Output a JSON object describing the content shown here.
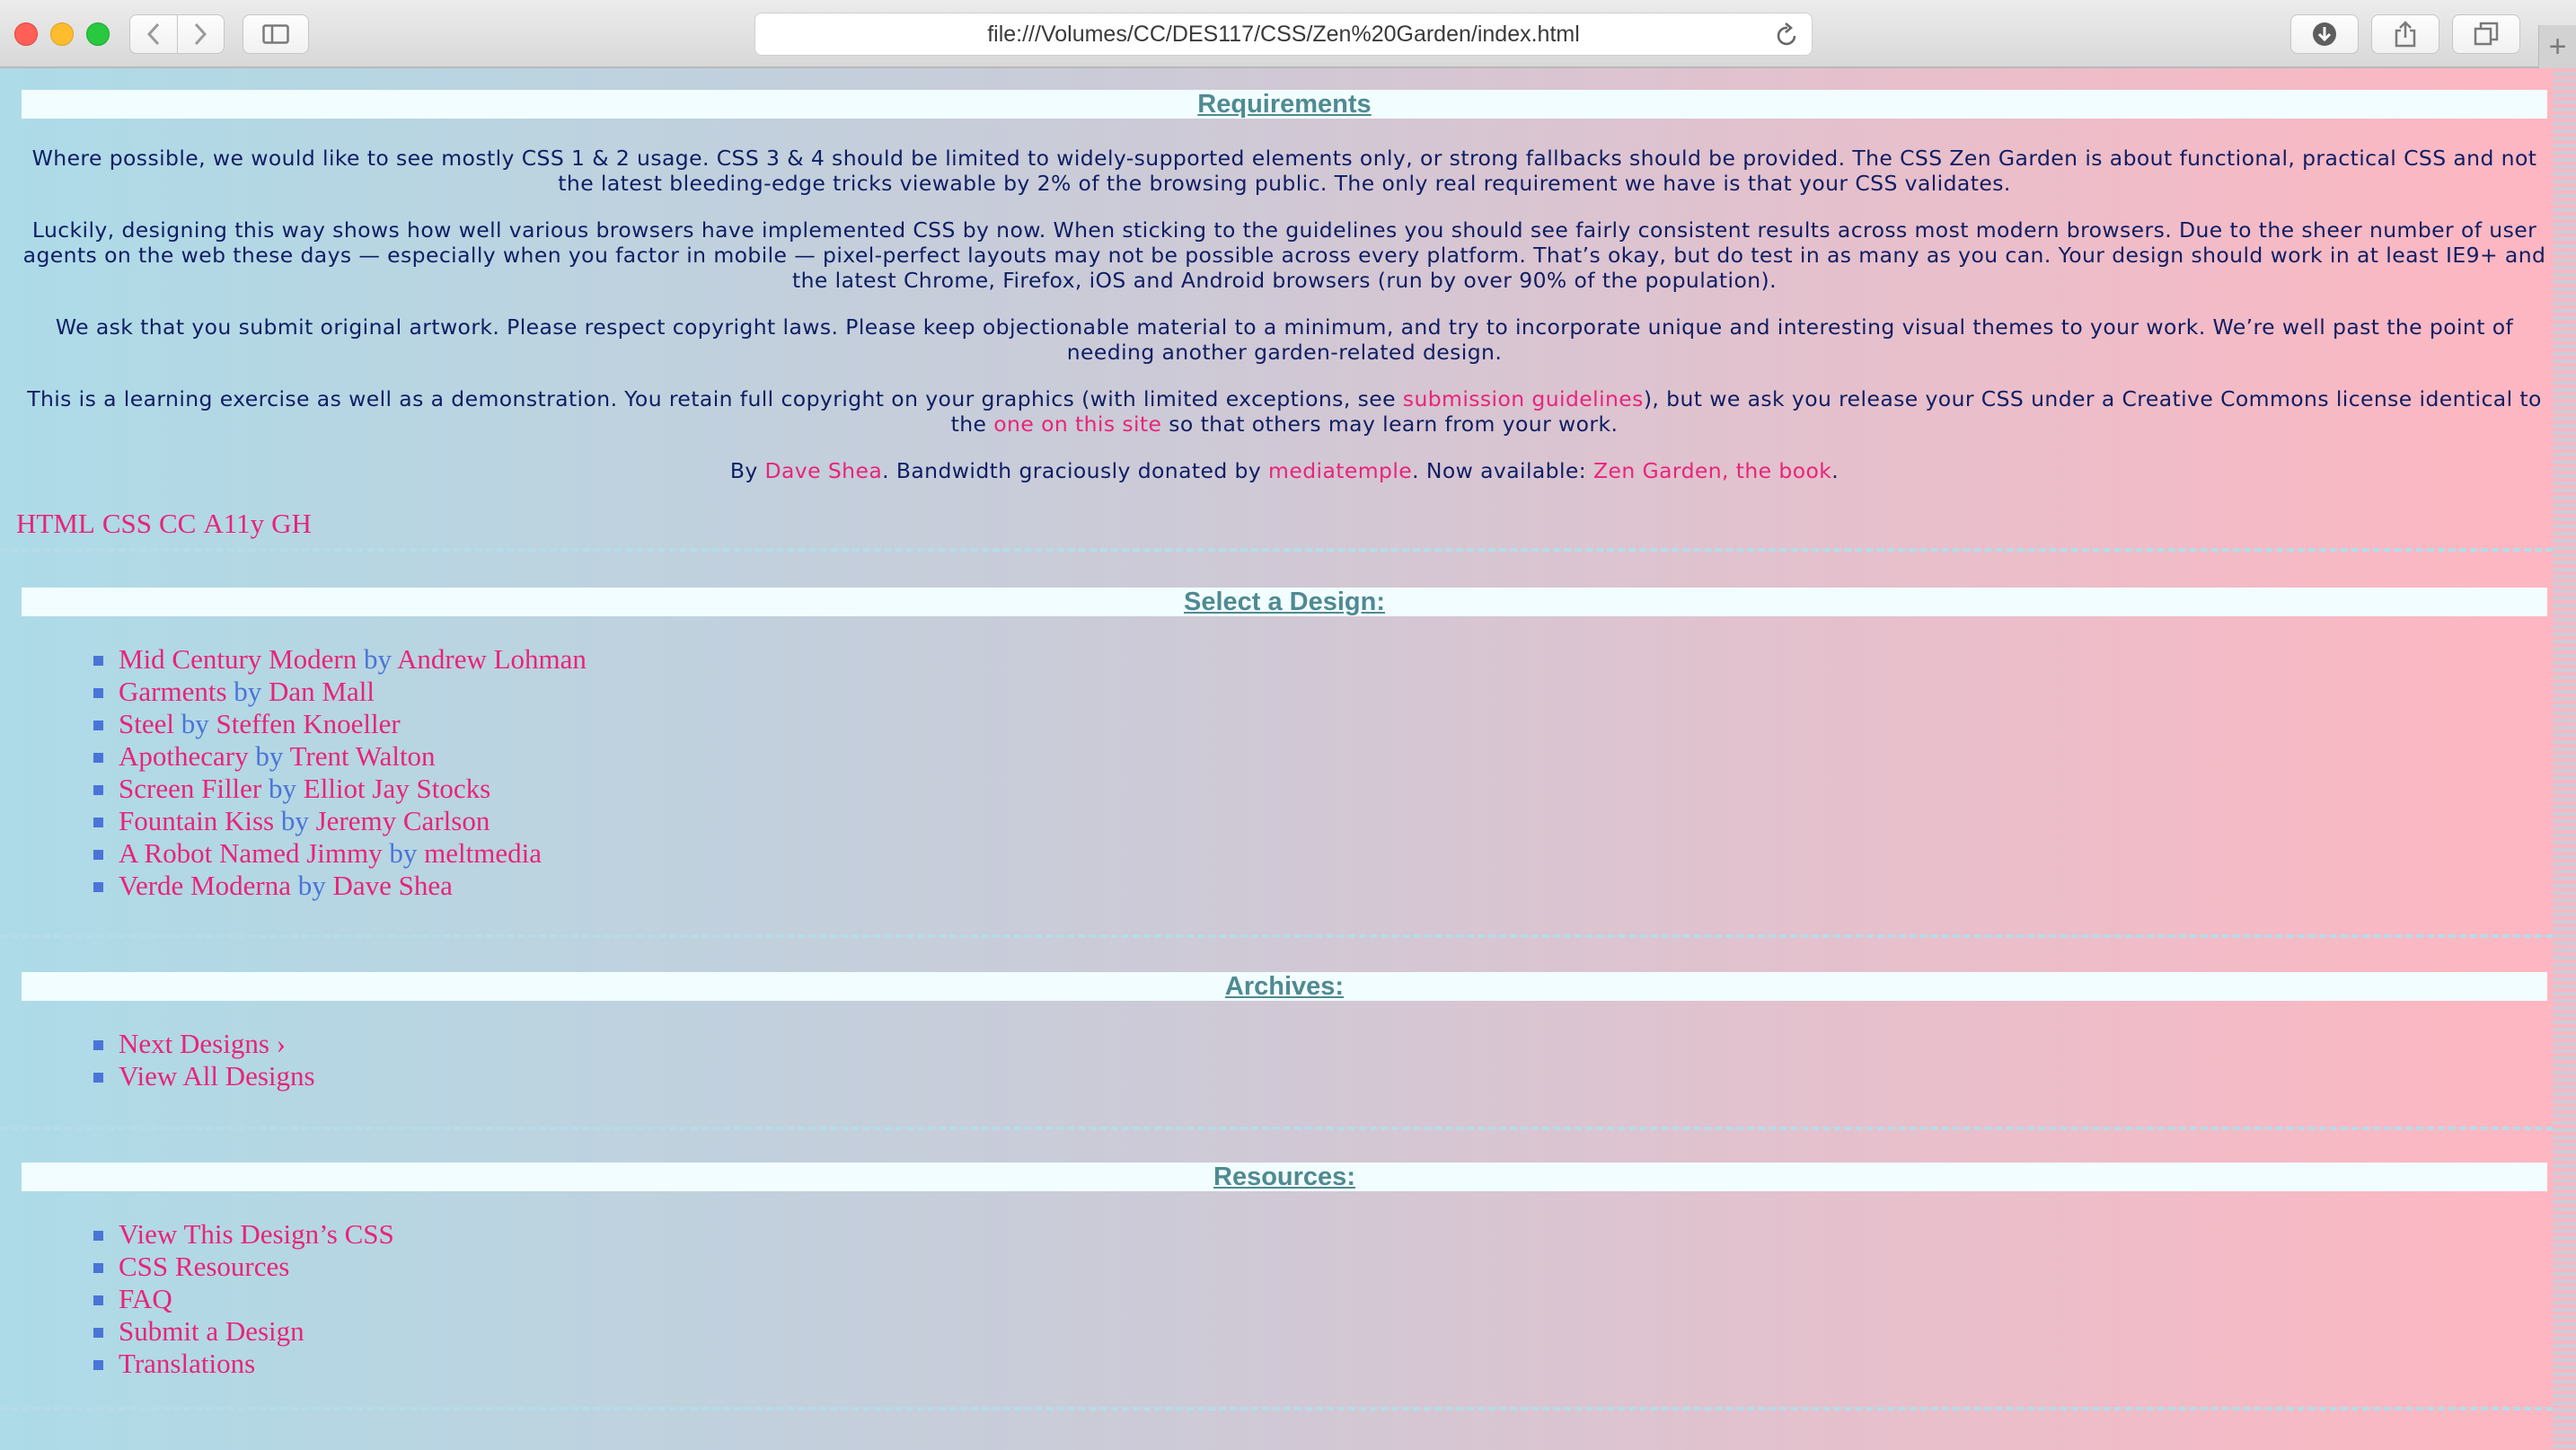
{
  "browser": {
    "url": "file:///Volumes/CC/DES117/CSS/Zen%20Garden/index.html",
    "new_tab_label": "+"
  },
  "requirements": {
    "heading": "Requirements",
    "p1": "Where possible, we would like to see mostly CSS 1 & 2 usage. CSS 3 & 4 should be limited to widely-supported elements only, or strong fallbacks should be provided. The CSS Zen Garden is about functional, practical CSS and not the latest bleeding-edge tricks viewable by 2% of the browsing public. The only real requirement we have is that your CSS validates.",
    "p2": "Luckily, designing this way shows how well various browsers have implemented CSS by now. When sticking to the guidelines you should see fairly consistent results across most modern browsers. Due to the sheer number of user agents on the web these days — especially when you factor in mobile — pixel-perfect layouts may not be possible across every platform. That’s okay, but do test in as many as you can. Your design should work in at least IE9+ and the latest Chrome, Firefox, iOS and Android browsers (run by over 90% of the population).",
    "p3": "We ask that you submit original artwork. Please respect copyright laws. Please keep objectionable material to a minimum, and try to incorporate unique and interesting visual themes to your work. We’re well past the point of needing another garden-related design.",
    "p4_a": "This is a learning exercise as well as a demonstration. You retain full copyright on your graphics (with limited exceptions, see ",
    "p4_link1": "submission guidelines",
    "p4_b": "), but we ask you release your CSS under a Creative Commons license identical to the ",
    "p4_link2": "one on this site",
    "p4_c": " so that others may learn from your work."
  },
  "credits": {
    "by": "By ",
    "author": "Dave Shea",
    "bandwidth": ". Bandwidth graciously donated by ",
    "host": "mediatemple",
    "now": ". Now available: ",
    "book": "Zen Garden, the book",
    "end": "."
  },
  "validators": [
    "HTML",
    "CSS",
    "CC",
    "A11y",
    "GH"
  ],
  "select_design": {
    "heading": "Select a Design:",
    "by_label": "by",
    "items": [
      {
        "design": "Mid Century Modern",
        "designer": "Andrew Lohman"
      },
      {
        "design": "Garments",
        "designer": "Dan Mall"
      },
      {
        "design": "Steel",
        "designer": "Steffen Knoeller"
      },
      {
        "design": "Apothecary",
        "designer": "Trent Walton"
      },
      {
        "design": "Screen Filler",
        "designer": "Elliot Jay Stocks"
      },
      {
        "design": "Fountain Kiss",
        "designer": "Jeremy Carlson"
      },
      {
        "design": "A Robot Named Jimmy",
        "designer": "meltmedia"
      },
      {
        "design": "Verde Moderna",
        "designer": "Dave Shea"
      }
    ]
  },
  "archives": {
    "heading": "Archives:",
    "items": [
      "Next Designs ›",
      "View All Designs"
    ]
  },
  "resources": {
    "heading": "Resources:",
    "items": [
      "View This Design’s CSS",
      "CSS Resources",
      "FAQ",
      "Submit a Design",
      "Translations"
    ]
  },
  "colors": {
    "link": "#e8247a",
    "body_text": "#0f1e63",
    "heading": "#4f8a91",
    "bullet": "#4a74d8",
    "gradient_left": "#addbe8",
    "gradient_right": "#ffb6c1"
  }
}
